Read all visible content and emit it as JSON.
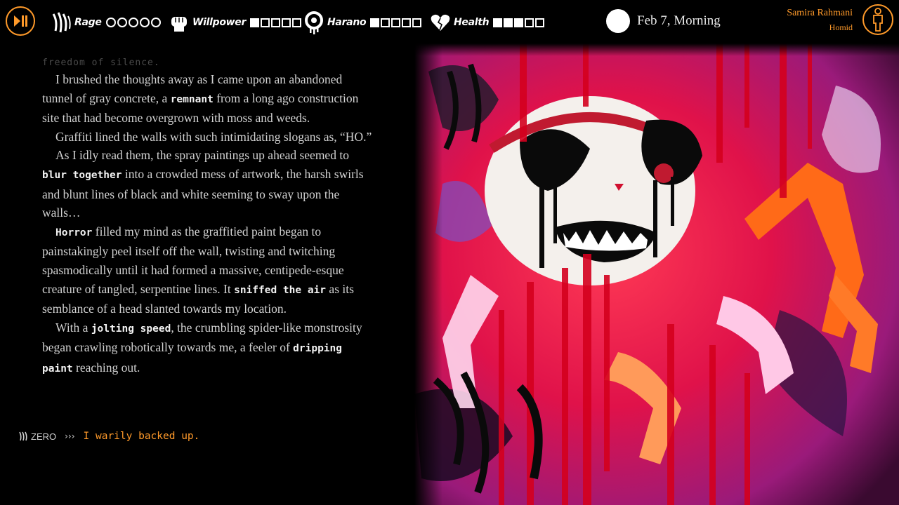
{
  "colors": {
    "accent": "#ff9a2a",
    "background": "#000000",
    "text": "#d2d2d2"
  },
  "topbar": {
    "menu_icon": "play-pause-icon",
    "stats": [
      {
        "label": "Rage",
        "icon": "claw-marks-icon",
        "type": "circles",
        "max": 5,
        "filled": 0
      },
      {
        "label": "Willpower",
        "icon": "fist-icon",
        "type": "squares",
        "max": 5,
        "filled": 1
      },
      {
        "label": "Harano",
        "icon": "dripping-skull-icon",
        "type": "squares",
        "max": 5,
        "filled": 1
      },
      {
        "label": "Health",
        "icon": "broken-heart-icon",
        "type": "squares",
        "max": 5,
        "filled": 3
      }
    ],
    "time_icon": "full-moon-icon",
    "date": "Feb 7, Morning",
    "character": {
      "name": "Samira Rahmani",
      "form": "Homid",
      "avatar_icon": "person-silhouette-icon"
    }
  },
  "story": {
    "faded_line": "freedom of silence.",
    "p1_a": "I brushed the thoughts away as I came upon an abandoned tunnel of gray concrete, a ",
    "p1_hl": "remnant",
    "p1_b": " from a long ago construction site that had become overgrown with moss and weeds.",
    "p2": "Graffiti lined the walls with such intimidating slogans as, “HO.”",
    "p3_a": "As I idly read them, the spray paintings up ahead seemed to ",
    "p3_hl": "blur together",
    "p3_b": " into a crowded mess of artwork, the harsh swirls and blunt lines of black and white seeming to sway upon the walls…",
    "p4_hl1": "Horror",
    "p4_a": " filled my mind as the graffitied paint began to painstakingly peel itself off the wall, twisting and twitching spasmodically until it had formed a massive, centipede-esque creature of tangled, serpentine lines. It ",
    "p4_hl2": "sniffed the air",
    "p4_b": " as its semblance of a head slanted towards my location.",
    "p5_a": "With a ",
    "p5_hl1": "jolting speed",
    "p5_b": ", the crumbling spider-like monstrosity began crawling robotically towards me, a feeler of ",
    "p5_hl2": "dripping paint",
    "p5_c": " reaching out."
  },
  "choice": {
    "speaker": "ZERO",
    "arrow": "›››",
    "text": "I warily backed up."
  },
  "art": {
    "subject": "graffiti spider monster illustration"
  }
}
